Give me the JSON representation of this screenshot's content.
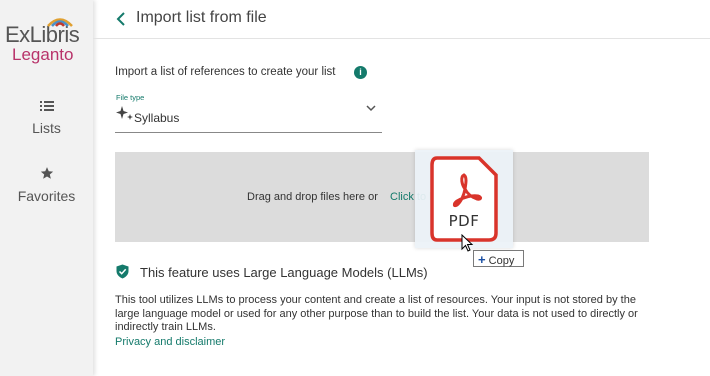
{
  "brand": {
    "name_top": "ExLibris",
    "name_bottom": "Leganto"
  },
  "sidebar": {
    "items": [
      {
        "label": "Lists",
        "icon": "list-icon"
      },
      {
        "label": "Favorites",
        "icon": "star-icon"
      }
    ]
  },
  "header": {
    "title": "Import list from file"
  },
  "main": {
    "intro": "Import a list of references to create your list",
    "file_type": {
      "label": "File type",
      "value": "Syllabus"
    },
    "dropzone": {
      "text": "Drag and drop files here or",
      "link": "Click to browse a file"
    },
    "drag": {
      "file_label": "PDF",
      "action_label": "Copy"
    },
    "llm": {
      "title": "This feature uses Large Language Models (LLMs)",
      "description": "This tool utilizes LLMs to process your content and create a list of resources. Your input is not stored by the large language model or used for any other purpose than to build the list. Your data is not used to directly or indirectly train LLMs.",
      "link": "Privacy and disclaimer"
    }
  },
  "colors": {
    "accent": "#147a6b",
    "brand_pink": "#b8336a",
    "pdf_red": "#d9342b"
  }
}
